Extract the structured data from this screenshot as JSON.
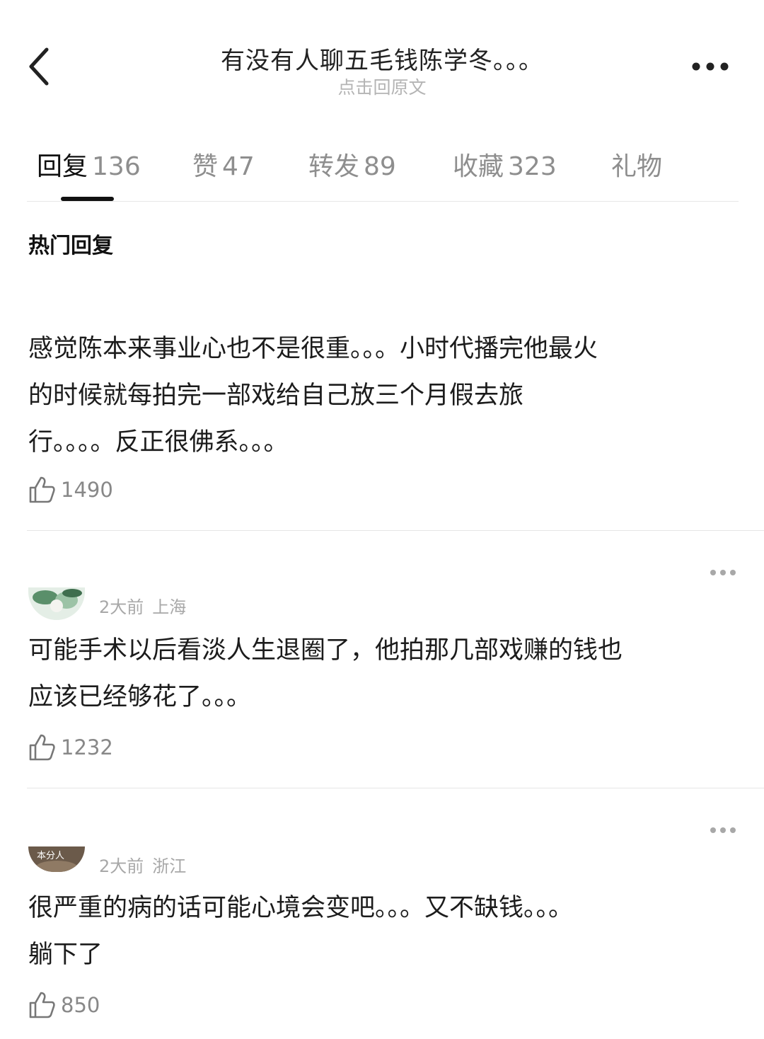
{
  "header": {
    "title": "有没有人聊五毛钱陈学冬。。。",
    "subtitle": "点击回原文",
    "back_icon": "chevron-left-icon",
    "more_icon": "more-dots-icon"
  },
  "tabs": [
    {
      "label": "回复",
      "count": "136",
      "active": true
    },
    {
      "label": "赞",
      "count": "47"
    },
    {
      "label": "转发",
      "count": "89"
    },
    {
      "label": "收藏",
      "count": "323"
    },
    {
      "label": "礼物",
      "count": ""
    }
  ],
  "section_title": "热门回复",
  "comments": [
    {
      "lines": [
        "感觉陈本来事业心也不是很重。。。小时代播完他最火",
        "的时候就每拍完一部戏给自己放三个月假去旅",
        "行。。。。反正很佛系。。。"
      ],
      "likes": "1490"
    },
    {
      "time": "2大前",
      "location": "上海",
      "lines": [
        "可能手术以后看淡人生退圈了，他拍那几部戏赚的钱也",
        "应该已经够花了。。。"
      ],
      "likes": "1232"
    },
    {
      "avatar_label": "本分人",
      "time": "2大前",
      "location": "浙江",
      "lines": [
        "很严重的病的话可能心境会变吧。。。又不缺钱。。。",
        "躺下了"
      ],
      "likes": "850"
    }
  ],
  "colors": {
    "text": "#1c1c1c",
    "muted": "#8e8e8e",
    "subtitle": "#b4b4b4",
    "divider": "#e6e6e6",
    "indicator": "#111111"
  }
}
